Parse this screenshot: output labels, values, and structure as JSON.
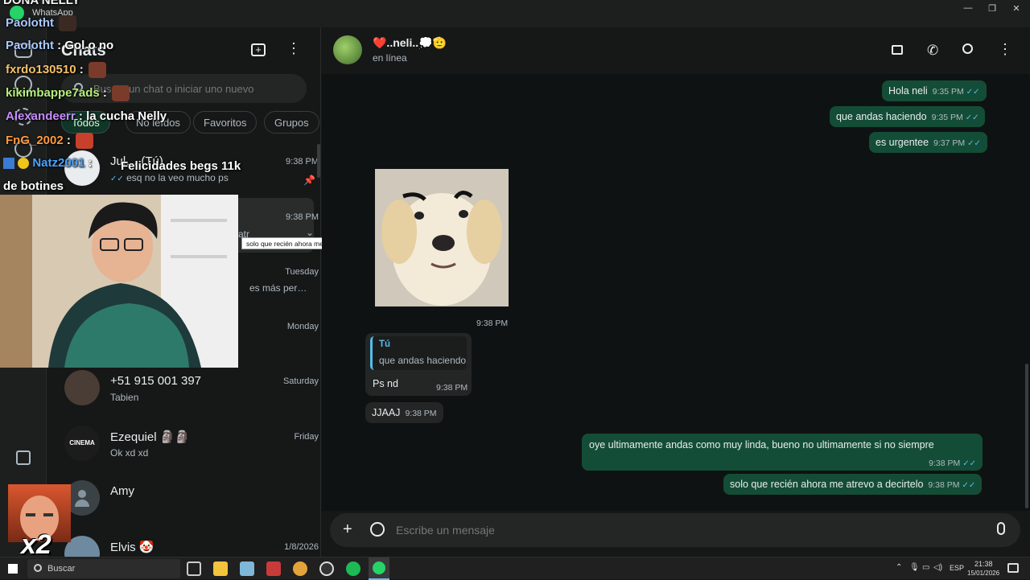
{
  "window": {
    "app_name": "WhatsApp"
  },
  "sidebar_panel": {
    "title": "Chats",
    "search_placeholder": "Buscar un chat o iniciar uno nuevo",
    "filters": [
      "Todos",
      "No leídos",
      "Favoritos",
      "Grupos"
    ],
    "chats": [
      {
        "name": "Jul… (Tú)",
        "time": "9:38 PM",
        "preview": "esq no la veo mucho ps",
        "ticks": "✓✓",
        "pinned": true
      },
      {
        "name": "",
        "time": "9:38 PM",
        "preview": "atr",
        "tooltip": "solo que recién ahora me atrevo a decirtelo"
      },
      {
        "name": "",
        "time": "Tuesday",
        "preview": "es más per…"
      },
      {
        "name": "",
        "time": "Monday",
        "preview": ""
      },
      {
        "name": "+51 915 001 397",
        "time": "Saturday",
        "preview": "Tabien"
      },
      {
        "name": "Ezequiel 🗿🗿",
        "time": "Friday",
        "preview": "Ok xd xd",
        "avatar_text": "CINEMA"
      },
      {
        "name": "Amy",
        "time": "",
        "preview": ""
      },
      {
        "name": "Elvis 🤡",
        "time": "1/8/2026",
        "preview": ""
      }
    ]
  },
  "chat_header": {
    "contact_name": "❤️..neli..💭🫡",
    "status": "en línea"
  },
  "messages": [
    {
      "dir": "out",
      "text": "Hola neli",
      "time": "9:35 PM",
      "ticks": "✓✓"
    },
    {
      "dir": "out",
      "text": "que andas haciendo",
      "time": "9:35 PM",
      "ticks": "✓✓"
    },
    {
      "dir": "out",
      "text": "es urgentee",
      "time": "9:37 PM",
      "ticks": "✓✓"
    },
    {
      "dir": "in",
      "type": "sticker",
      "time": "9:38 PM"
    },
    {
      "dir": "in",
      "quote_author": "Tú",
      "quote_text": "que andas haciendo",
      "text": "Ps nd",
      "time": "9:38 PM"
    },
    {
      "dir": "in",
      "text": "JJAAJ",
      "time": "9:38 PM"
    },
    {
      "dir": "out",
      "text": "oye ultimamente andas como muy linda, bueno no ultimamente si no siempre",
      "time": "9:38 PM",
      "ticks": "✓✓"
    },
    {
      "dir": "out",
      "text": "solo que recién ahora me atrevo a decirtelo",
      "time": "9:38 PM",
      "ticks": "✓✓"
    }
  ],
  "composer": {
    "placeholder": "Escribe un mensaje"
  },
  "stream_chat": [
    {
      "user": "DOÑA NELLY",
      "text": "",
      "color": "#f2f2f2"
    },
    {
      "user": "Paolotht",
      "text": "",
      "color": "#a9c9ff"
    },
    {
      "user": "Paolotht",
      "text": "Gol o no",
      "color": "#a9c9ff"
    },
    {
      "user": "fxrdo130510",
      "text": "",
      "color": "#f5c16c"
    },
    {
      "user": "kikimbappe7ads",
      "text": "",
      "color": "#b6f07a"
    },
    {
      "user": "Alexandeerr",
      "text": "la cucha Nelly",
      "color": "#c78cff"
    },
    {
      "user": "FnG_2002",
      "text": "",
      "color": "#ff9a3d"
    },
    {
      "user": "Natz2001",
      "text": "Felicidades begs 11k de botines",
      "color": "#4aa3ff"
    }
  ],
  "overlay_badge": "x2",
  "taskbar": {
    "search_label": "Buscar",
    "lang": "ESP",
    "time": "21:38",
    "date": "15/01/2026"
  },
  "colors": {
    "outgoing_bubble": "#144d37",
    "incoming_bubble": "#242626",
    "read_ticks": "#53bdeb",
    "accent": "#25d366"
  }
}
